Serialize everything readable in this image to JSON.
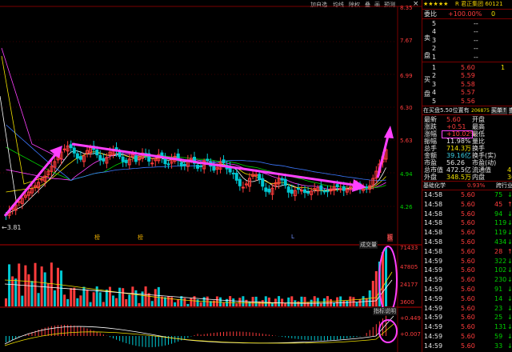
{
  "toolbar": {
    "items": [
      "加自选",
      "均线",
      "除权",
      "叠",
      "画",
      "预测"
    ],
    "close": "×"
  },
  "price_axis": [
    "8.35",
    "7.67",
    "6.99",
    "6.30",
    "5.63",
    "4.94",
    "4.26"
  ],
  "price_axis_colors": [
    "#ff3c3c",
    "#ff3c3c",
    "#ff3c3c",
    "#ff3c3c",
    "#ff3c3c",
    "#00d200",
    "#00d200"
  ],
  "low_label": "←3.81",
  "markers": {
    "m1": "榜",
    "m2": "榜",
    "m3": "L",
    "m4": "板"
  },
  "volume": {
    "label": "成交量",
    "axis": [
      "71433",
      "47805",
      "24177",
      "3600"
    ]
  },
  "indicator": {
    "label": "指标说明",
    "axis": [
      "+0.449",
      "+0.007"
    ]
  },
  "header": {
    "stars": "★★★★★",
    "title": "R 君正集团 60121"
  },
  "ratio": {
    "label": "委比",
    "value": "+100.00%",
    "extra": "0"
  },
  "sell": {
    "side1": "卖",
    "side2": "盘",
    "levels": [
      {
        "n": "5",
        "p": "--",
        "v": ""
      },
      {
        "n": "4",
        "p": "--",
        "v": ""
      },
      {
        "n": "3",
        "p": "--",
        "v": ""
      },
      {
        "n": "2",
        "p": "--",
        "v": ""
      },
      {
        "n": "1",
        "p": "--",
        "v": ""
      }
    ]
  },
  "buy": {
    "side1": "买",
    "side2": "盘",
    "levels": [
      {
        "n": "1",
        "p": "5.60",
        "v": "1"
      },
      {
        "n": "2",
        "p": "5.59",
        "v": ""
      },
      {
        "n": "3",
        "p": "5.58",
        "v": ""
      },
      {
        "n": "4",
        "p": "5.57",
        "v": ""
      },
      {
        "n": "5",
        "p": "5.56",
        "v": ""
      }
    ]
  },
  "status": {
    "text": "在买盘5.50位置有",
    "vol": "206875",
    "b1": "买单↑",
    "b2": "查"
  },
  "quote_rows": [
    {
      "l1": "最新",
      "v1": "5.60",
      "c1": "red",
      "l2": "开盘",
      "v2": ""
    },
    {
      "l1": "涨跌",
      "v1": "+0.51",
      "c1": "red",
      "l2": "最高",
      "v2": ""
    },
    {
      "l1": "涨幅",
      "v1": "+10.02%",
      "c1": "red",
      "l2": "最低",
      "v2": ""
    },
    {
      "l1": "振幅",
      "v1": "11.98%",
      "c1": "wht",
      "l2": "量比",
      "v2": ""
    },
    {
      "l1": "总手",
      "v1": "714.3万",
      "c1": "yel",
      "l2": "换手",
      "v2": ""
    },
    {
      "l1": "金额",
      "v1": "39.16亿",
      "c1": "cyan",
      "l2": "换手(实)",
      "v2": ""
    },
    {
      "l1": "市盈",
      "v1": "56.26",
      "c1": "wht",
      "l2": "市盈(动)",
      "v2": ""
    },
    {
      "l1": "总市值",
      "v1": "472.5亿",
      "c1": "wht",
      "l2": "流通值",
      "v2": "4"
    },
    {
      "l1": "外盘",
      "v1": "348.5万",
      "c1": "yel",
      "l2": "内盘",
      "v2": "36"
    }
  ],
  "tick_header": {
    "a": "基础化学",
    "b": "0.93%",
    "c": "跨行业"
  },
  "ticks": [
    {
      "t": "14:58",
      "p": "5.60",
      "v": "75",
      "d": "↓"
    },
    {
      "t": "14:58",
      "p": "5.60",
      "v": "45",
      "d": "↑"
    },
    {
      "t": "14:58",
      "p": "5.60",
      "v": "94",
      "d": "↓"
    },
    {
      "t": "14:58",
      "p": "5.60",
      "v": "119",
      "d": "↓"
    },
    {
      "t": "14:58",
      "p": "5.60",
      "v": "119",
      "d": "↓"
    },
    {
      "t": "14:58",
      "p": "5.60",
      "v": "434",
      "d": "↓"
    },
    {
      "t": "14:58",
      "p": "5.60",
      "v": "28",
      "d": "↑"
    },
    {
      "t": "14:59",
      "p": "5.60",
      "v": "322",
      "d": "↓"
    },
    {
      "t": "14:59",
      "p": "5.60",
      "v": "102",
      "d": "↓"
    },
    {
      "t": "14:59",
      "p": "5.60",
      "v": "230",
      "d": "↓"
    },
    {
      "t": "14:59",
      "p": "5.60",
      "v": "91",
      "d": "↓"
    },
    {
      "t": "14:59",
      "p": "5.60",
      "v": "14",
      "d": "↓"
    },
    {
      "t": "14:59",
      "p": "5.60",
      "v": "23",
      "d": "↓"
    },
    {
      "t": "14:59",
      "p": "5.60",
      "v": "25",
      "d": "↓"
    },
    {
      "t": "14:59",
      "p": "5.60",
      "v": "131",
      "d": "↓"
    },
    {
      "t": "14:59",
      "p": "5.60",
      "v": "59",
      "d": "↓"
    },
    {
      "t": "14:59",
      "p": "5.60",
      "v": "33",
      "d": "↓"
    }
  ],
  "colors": {
    "up": "#ff3c3c",
    "down": "#00d200",
    "grid": "#7a0000",
    "arrow": "#ff40ff",
    "axis_up": "#ff3c3c"
  }
}
